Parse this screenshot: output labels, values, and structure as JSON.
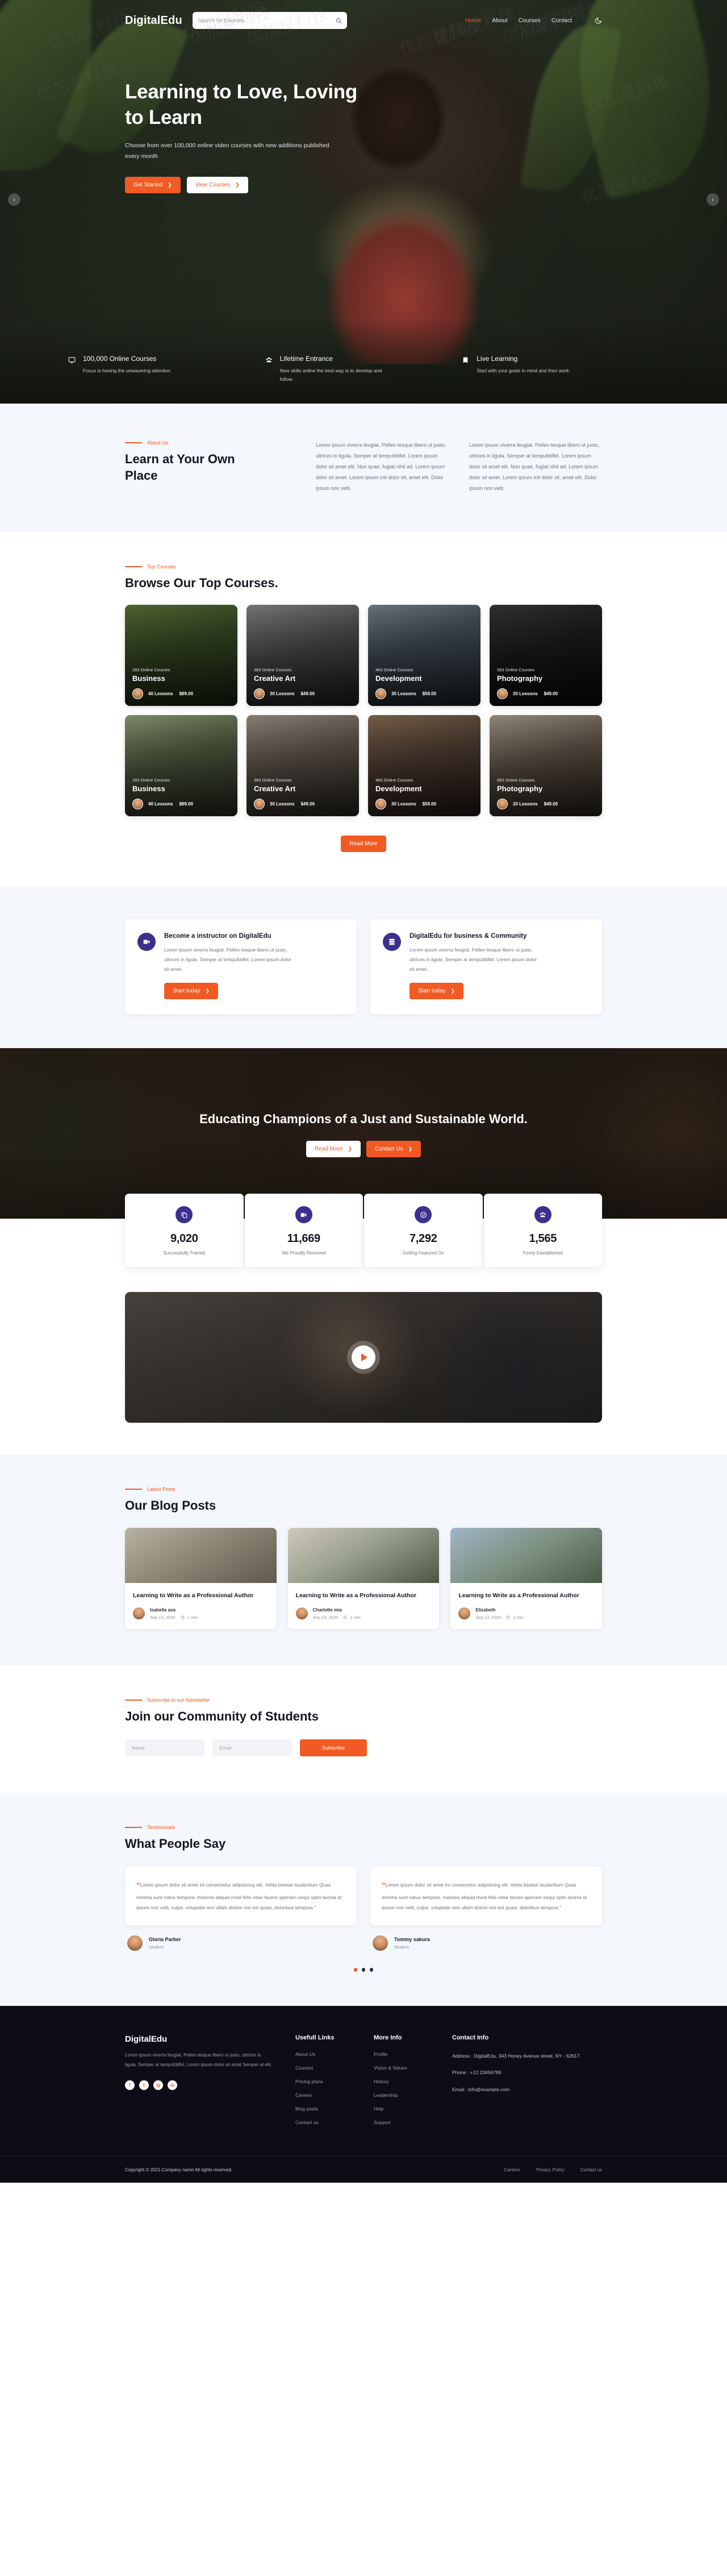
{
  "brand": "DigitalEdu",
  "nav": {
    "search_placeholder": "Search for Courses..",
    "links": [
      {
        "label": "Home",
        "active": true
      },
      {
        "label": "About",
        "active": false
      },
      {
        "label": "Courses",
        "active": false
      },
      {
        "label": "Contact",
        "active": false
      }
    ],
    "theme_icon": "moon-icon"
  },
  "hero": {
    "title": "Learning to Love, Loving to Learn",
    "subtitle": "Choose from over 100,000 online video courses with new additions published every month",
    "primary_btn": "Get Started",
    "secondary_btn": "View Courses",
    "prev": "‹",
    "next": "›"
  },
  "features": [
    {
      "icon": "monitor-icon",
      "title": "100,000 Online Courses",
      "desc": "Focus is having the unwavering attention."
    },
    {
      "icon": "users-icon",
      "title": "Lifetime Entrance",
      "desc": "New skills online the best way is to develop and follow."
    },
    {
      "icon": "book-icon",
      "title": "Live Learning",
      "desc": "Start with your goals in mind and then work."
    }
  ],
  "about": {
    "eyebrow": "About Us",
    "title": "Learn at Your Own Place",
    "col1": "Lorem ipsum viverra feugiat. Pellen tesque libero ut justo, ultrices in ligula. Semper at tempufddfel. Lorem ipsum dolor sit amet elit. Non quae, fugiat nihil ad. Lorem ipsum dolor sit amet. Lorem ipsum init dolor sit, amet elit. Dolor ipsum non velit.",
    "col2": "Lorem ipsum viverra feugiat. Pellen tesque libero ut justo, ultrices in ligula. Semper at tempufddfel. Lorem ipsum dolor sit amet elit. Non quae, fugiat nihil ad. Lorem ipsum dolor sit amet. Lorem ipsum init dolor sit, amet elit. Dolor ipsum non velit."
  },
  "courses": {
    "eyebrow": "Top Courses",
    "title": "Browse Our Top Courses.",
    "more_btn": "Read More",
    "items": [
      {
        "sub": "283 Online Courses",
        "title": "Business",
        "lessons": "40 Lessons",
        "price": "$89.00"
      },
      {
        "sub": "383 Online Courses",
        "title": "Creative Art",
        "lessons": "30 Lessons",
        "price": "$49.00"
      },
      {
        "sub": "483 Online Courses",
        "title": "Development",
        "lessons": "30 Lessons",
        "price": "$59.00"
      },
      {
        "sub": "583 Online Courses",
        "title": "Photography",
        "lessons": "20 Lessons",
        "price": "$49.00"
      },
      {
        "sub": "283 Online Courses",
        "title": "Business",
        "lessons": "40 Lessons",
        "price": "$89.00"
      },
      {
        "sub": "383 Online Courses",
        "title": "Creative Art",
        "lessons": "30 Lessons",
        "price": "$49.00"
      },
      {
        "sub": "483 Online Courses",
        "title": "Development",
        "lessons": "30 Lessons",
        "price": "$59.00"
      },
      {
        "sub": "583 Online Courses",
        "title": "Photography",
        "lessons": "20 Lessons",
        "price": "$49.00"
      }
    ]
  },
  "cta_cards": [
    {
      "icon": "video-camera-icon",
      "title": "Become a instructor on DigitalEdu",
      "desc": "Lorem ipsum viverra feugiat. Pellen tesque libero ut justo, ultrices in ligula. Semper at tempufddfel. Lorem ipsum dolor sit amet.",
      "btn": "Start today"
    },
    {
      "icon": "server-icon",
      "title": "DigitalEdu for business & Community",
      "desc": "Lorem ipsum viverra feugiat. Pellen tesque libero ut justo, ultrices in ligula. Semper at tempufddfel. Lorem ipsum dolor sit amet..",
      "btn": "Start today"
    }
  ],
  "champions": {
    "title": "Educating Champions of a Just and Sustainable World.",
    "btn_read": "Read More",
    "btn_contact": "Contact Us"
  },
  "stats": [
    {
      "icon": "copy-icon",
      "value": "9,020",
      "label": "Successfully Trained"
    },
    {
      "icon": "video-icon",
      "value": "11,669",
      "label": "We Proudly Received"
    },
    {
      "icon": "smile-icon",
      "value": "7,292",
      "label": "Getting Featured On"
    },
    {
      "icon": "group-icon",
      "value": "1,565",
      "label": "Firmly Eastablished"
    }
  ],
  "video": {
    "play_label": "play-button"
  },
  "blog": {
    "eyebrow": "Latest Posts",
    "title": "Our Blog Posts",
    "posts": [
      {
        "title": "Learning to Write as a Professional Author",
        "author": "Isabella ava",
        "date": "Sep 13, 2020 .",
        "read": "1 min"
      },
      {
        "title": "Learning to Write as a Professional Author",
        "author": "Charlotte mia",
        "date": "Sep 13, 2020 .",
        "read": "1 min"
      },
      {
        "title": "Learning to Write as a Professional Author",
        "author": "Elizabeth",
        "date": "Sep 13, 2020 .",
        "read": "1 min"
      }
    ]
  },
  "newsletter": {
    "eyebrow": "Subscribe to our Newsletter",
    "title": "Join our Community of Students",
    "name_placeholder": "Name",
    "email_placeholder": "Email",
    "submit": "Subscribe"
  },
  "testimonials": {
    "eyebrow": "Testimonials",
    "title": "What People Say",
    "items": [
      {
        "quote": "Lorem ipsum dolor sit amet int consectetur adipisicing elit. Velita beatae laudantium Quas minima sunt natus tempore, maiores aliquid modi felis vitae facere aperiam sequi optio lacinia id ipsum non velit, culpa. voluptate rem ullam dolore nisi est quasi, doloribus tempora.\"",
        "name": "Gloria Parker",
        "role": "Student"
      },
      {
        "quote": "Lorem ipsum dolor sit amet int consectetur adipisicing elit. Velita beatae laudantium Quas minima sunt natus tempore, maiores aliquid modi felis vitae facere aperiam sequi optio lacinia id ipsum non velit, culpa. voluptate rem ullam dolore nisi est quasi, doloribus tempora.\"",
        "name": "Tommy sakura",
        "role": "Student"
      }
    ]
  },
  "footer": {
    "brand": "DigitalEdu",
    "about": "Lorem ipsum viverra feugiat. Pellen tesque libero ut justo, ultrices in ligula. Semper at tempufddfel. Lorem ipsum dolor sit amet Semper at elit.",
    "socials": [
      "f",
      "t",
      "ig",
      "in"
    ],
    "useful_links_title": "Usefull Links",
    "useful_links": [
      "About Us",
      "Courses",
      "Pricing plans",
      "Careers",
      "Blog posts",
      "Contact us"
    ],
    "more_info_title": "More Info",
    "more_info": [
      "Profile",
      "Vision & Values",
      "History",
      "Leadership",
      "Help",
      "Support"
    ],
    "contact_title": "Contact Info",
    "address": "Address : DigitalEdu, 343 Honey Avenue street, NY - 62617.",
    "phone": "Phone : +12 23456799",
    "email": "Email : info@example.com",
    "copyright": "Copyright © 2021.Company name All rights reserved.",
    "bottom_links": [
      "Careers",
      "Privacy Policy",
      "Contact us"
    ]
  },
  "colors": {
    "accent": "#f15a22",
    "purple": "#3b2f8f",
    "dark": "#0e0d17",
    "light": "#f4f7fb"
  }
}
